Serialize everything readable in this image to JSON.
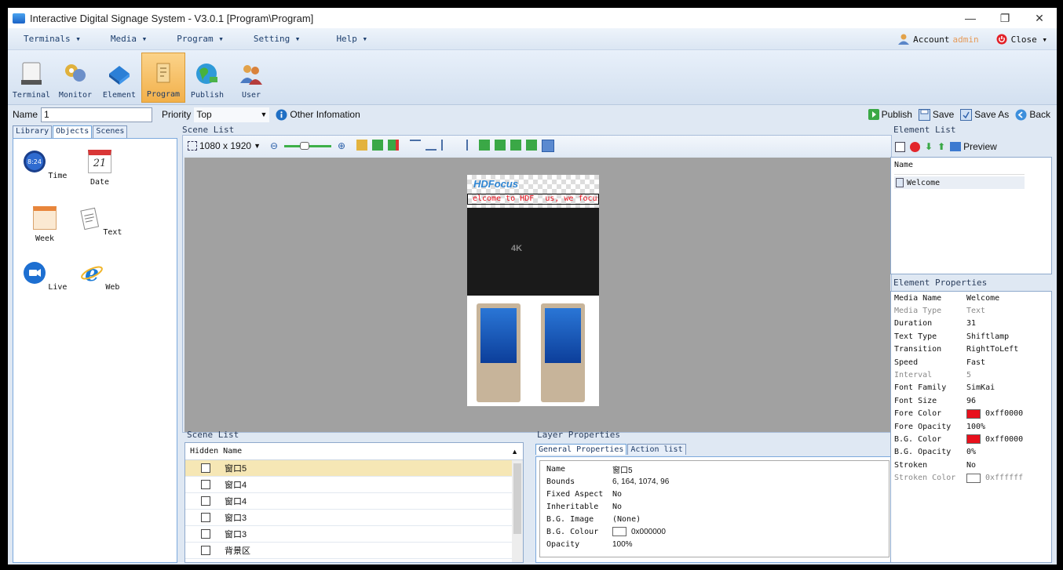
{
  "window": {
    "title": "Interactive Digital Signage System - V3.0.1 [Program\\Program]",
    "minimize": "—",
    "maximize": "❐",
    "close": "✕"
  },
  "menu": {
    "items": [
      "Terminals ▾",
      "Media ▾",
      "Program ▾",
      "Setting ▾",
      "Help ▾"
    ],
    "account_label": "Account",
    "account_user": "admin",
    "close_label": "Close ▾"
  },
  "toolbar": {
    "items": [
      {
        "label": "Terminal",
        "icon": "terminal-icon"
      },
      {
        "label": "Monitor",
        "icon": "monitor-icon"
      },
      {
        "label": "Element",
        "icon": "element-icon"
      },
      {
        "label": "Program",
        "icon": "program-icon",
        "active": true
      },
      {
        "label": "Publish",
        "icon": "publish-icon"
      },
      {
        "label": "User",
        "icon": "user-icon"
      }
    ]
  },
  "namebar": {
    "name_label": "Name",
    "name_value": "1",
    "priority_label": "Priority",
    "priority_value": "Top",
    "other_info": "Other Infomation",
    "publish": "Publish",
    "save": "Save",
    "save_as": "Save As",
    "back": "Back"
  },
  "library": {
    "tabs": [
      "Library",
      "Objects",
      "Scenes"
    ],
    "items": [
      "Time",
      "Date",
      "Week",
      "Text",
      "Live",
      "Web"
    ],
    "date_num": "21",
    "time_text": "8:24"
  },
  "scene": {
    "label": "Scene List",
    "resolution": "1080 x 1920",
    "banner_logo": "HDFocus",
    "banner_text": "elcome to HDF",
    "banner_text2": "us, we focus"
  },
  "scene_list": {
    "label": "Scene List",
    "col_hidden": "Hidden",
    "col_name": "Name",
    "rows": [
      "窗口5",
      "窗口4",
      "窗口4",
      "窗口3",
      "窗口3",
      "背景区"
    ]
  },
  "layer": {
    "label": "Layer Properties",
    "tabs": [
      "General Properties",
      "Action list"
    ],
    "props": [
      {
        "k": "Name",
        "v": "窗口5"
      },
      {
        "k": "Bounds",
        "v": "6, 164, 1074, 96"
      },
      {
        "k": "Fixed Aspect",
        "v": "No"
      },
      {
        "k": "Inheritable",
        "v": "No"
      },
      {
        "k": "B.G. Image",
        "v": "(None)"
      },
      {
        "k": "B.G. Colour",
        "v": "0x000000"
      },
      {
        "k": "Opacity",
        "v": "100%"
      }
    ]
  },
  "element_list": {
    "label": "Element List",
    "preview": "Preview",
    "col_name": "Name",
    "items": [
      "Welcome"
    ]
  },
  "element_props": {
    "label": "Element Properties",
    "rows": [
      {
        "k": "Media Name",
        "v": "Welcome"
      },
      {
        "k": "Media Type",
        "v": "Text",
        "dim": true
      },
      {
        "k": "Duration",
        "v": "31"
      },
      {
        "k": "Text Type",
        "v": "Shiftlamp"
      },
      {
        "k": "Transition",
        "v": "RightToLeft"
      },
      {
        "k": "Speed",
        "v": "Fast"
      },
      {
        "k": "Interval",
        "v": "5",
        "dim": true
      },
      {
        "k": "Font Family",
        "v": "SimKai"
      },
      {
        "k": "Font Size",
        "v": "96"
      },
      {
        "k": "Fore Color",
        "v": "0xff0000",
        "swatch": "#e8101c"
      },
      {
        "k": "Fore Opacity",
        "v": "100%"
      },
      {
        "k": "B.G. Color",
        "v": "0xff0000",
        "swatch": "#e8101c"
      },
      {
        "k": "B.G. Opacity",
        "v": "0%"
      },
      {
        "k": "Stroken",
        "v": "No"
      },
      {
        "k": "Stroken Color",
        "v": "0xffffff",
        "swatch": "#ffffff",
        "dim": true
      }
    ]
  }
}
